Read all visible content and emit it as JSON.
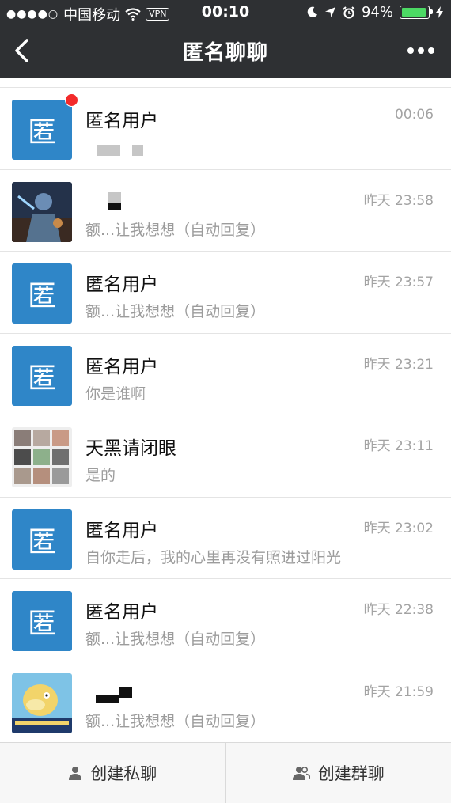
{
  "status_bar": {
    "signal": "●●●●○",
    "carrier": "中国移动",
    "vpn": "VPN",
    "time": "00:10",
    "battery": "94%",
    "battery_level": 0.94
  },
  "header": {
    "title": "匿名聊聊"
  },
  "avatar_glyph": "匿",
  "chats": [
    {
      "name": "匿名用户",
      "time": "00:06",
      "message": "",
      "unread": true
    },
    {
      "name": "",
      "time": "昨天 23:58",
      "message": "额...让我想想（自动回复）",
      "unread": false
    },
    {
      "name": "匿名用户",
      "time": "昨天 23:57",
      "message": "额...让我想想（自动回复）",
      "unread": false
    },
    {
      "name": "匿名用户",
      "time": "昨天 23:21",
      "message": "你是谁啊",
      "unread": false
    },
    {
      "name": "天黑请闭眼",
      "time": "昨天 23:11",
      "message": "是的",
      "unread": false
    },
    {
      "name": "匿名用户",
      "time": "昨天 23:02",
      "message": "自你走后，我的心里再没有照进过阳光",
      "unread": false
    },
    {
      "name": "匿名用户",
      "time": "昨天 22:38",
      "message": "额...让我想想（自动回复）",
      "unread": false
    },
    {
      "name": "",
      "time": "昨天 21:59",
      "message": "额...让我想想（自动回复）",
      "unread": false
    }
  ],
  "bottom_bar": {
    "private_chat_label": "创建私聊",
    "group_chat_label": "创建群聊"
  },
  "colors": {
    "header_bg": "#2e3033",
    "avatar_blue": "#2f86c8",
    "badge_red": "#f32a2a",
    "battery_green": "#4cd964"
  }
}
